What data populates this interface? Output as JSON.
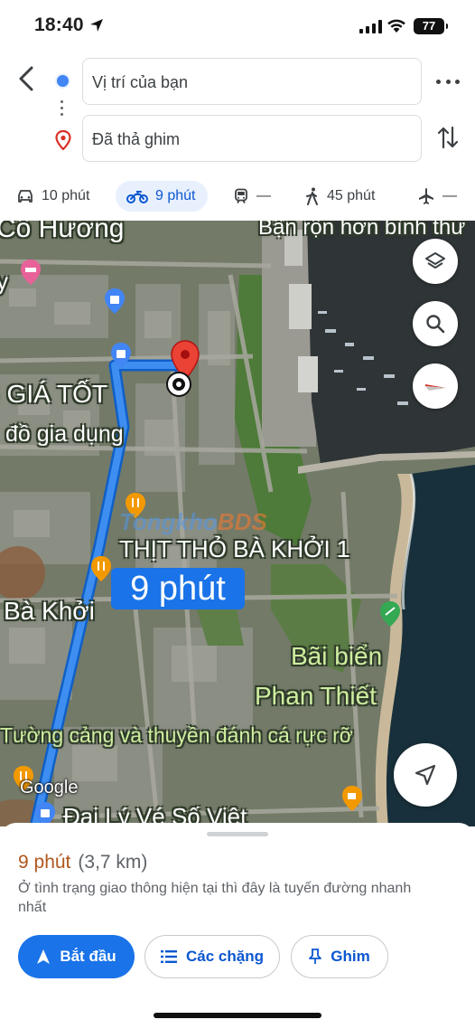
{
  "status_bar": {
    "time": "18:40",
    "battery": "77"
  },
  "route": {
    "origin_value": "Vị trí của bạn",
    "destination_value": "Đã thả ghim"
  },
  "modes": [
    {
      "name": "car",
      "label": "10 phút",
      "active": false
    },
    {
      "name": "motorbike",
      "label": "9 phút",
      "active": true
    },
    {
      "name": "transit",
      "label": "—",
      "active": false
    },
    {
      "name": "walk",
      "label": "45 phút",
      "active": false
    },
    {
      "name": "flight",
      "label": "—",
      "active": false
    }
  ],
  "map": {
    "labels": {
      "co_huong": "Cô Hương",
      "ban_ron": "Bận rộn hơn bình thư",
      "y": "y",
      "gia_tot": "G GIÁ TỐT",
      "do_gia_dung": "đồ gia dụng",
      "thit_tho": "THỊT THỎ BÀ KHỞI 1",
      "ba_khoi": "Bà Khởi",
      "bai_bien_1": "Bãi biển",
      "bai_bien_2": "Phan Thiết",
      "tuong_cang": "Tường cảng và thuyền đánh cá rực rỡ",
      "dai_ly": "Đại Lý Vé Số Việt"
    },
    "duration_tag": "9 phút",
    "google_logo": "Google",
    "watermark_a": "Tongkho",
    "watermark_b": "BDS"
  },
  "sheet": {
    "time": "9 phút",
    "distance": "(3,7 km)",
    "description": "Ở tình trạng giao thông hiện tại thì đây là tuyến đường nhanh nhất",
    "start_label": "Bắt đầu",
    "steps_label": "Các chặng",
    "pin_label": "Ghim"
  },
  "colors": {
    "accent": "#1a73e8",
    "time_orange": "#b0561d",
    "route_blue": "#1a73e8"
  }
}
